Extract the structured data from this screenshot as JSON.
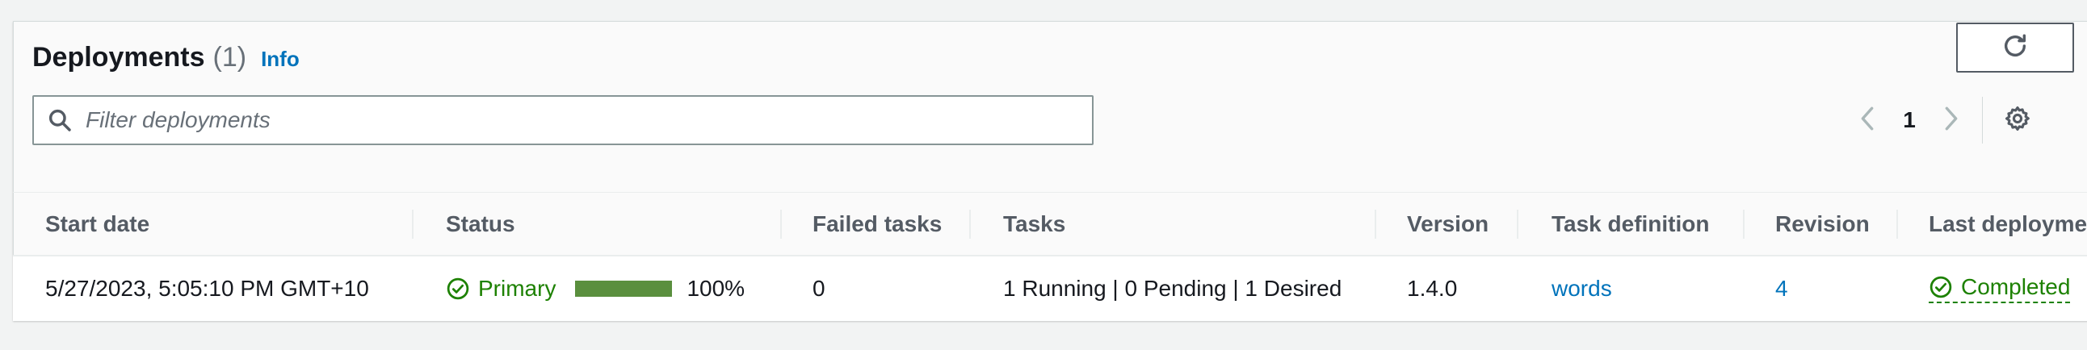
{
  "header": {
    "title": "Deployments",
    "count": "(1)",
    "info_label": "Info"
  },
  "search": {
    "placeholder": "Filter deployments",
    "value": ""
  },
  "pagination": {
    "current_page": "1"
  },
  "table": {
    "columns": [
      "Start date",
      "Status",
      "Failed tasks",
      "Tasks",
      "Version",
      "Task definition",
      "Revision",
      "Last deployme"
    ],
    "rows": [
      {
        "start_date": "5/27/2023, 5:05:10 PM GMT+10",
        "status": "Primary",
        "progress_percent": 100,
        "progress_label": "100%",
        "failed_tasks": "0",
        "tasks": "1 Running | 0 Pending | 1 Desired",
        "version": "1.4.0",
        "task_definition": "words",
        "revision": "4",
        "last_deployment": "Completed"
      }
    ]
  },
  "icons": {
    "search": "search-icon",
    "refresh": "refresh-icon",
    "prev": "chevron-left-icon",
    "next": "chevron-right-icon",
    "settings": "gear-icon",
    "status_ok": "check-circle-icon"
  },
  "colors": {
    "link": "#0073bb",
    "success": "#1d8102",
    "progress_fill": "#5a8f3e",
    "heading": "#16191f",
    "muted": "#687078"
  }
}
